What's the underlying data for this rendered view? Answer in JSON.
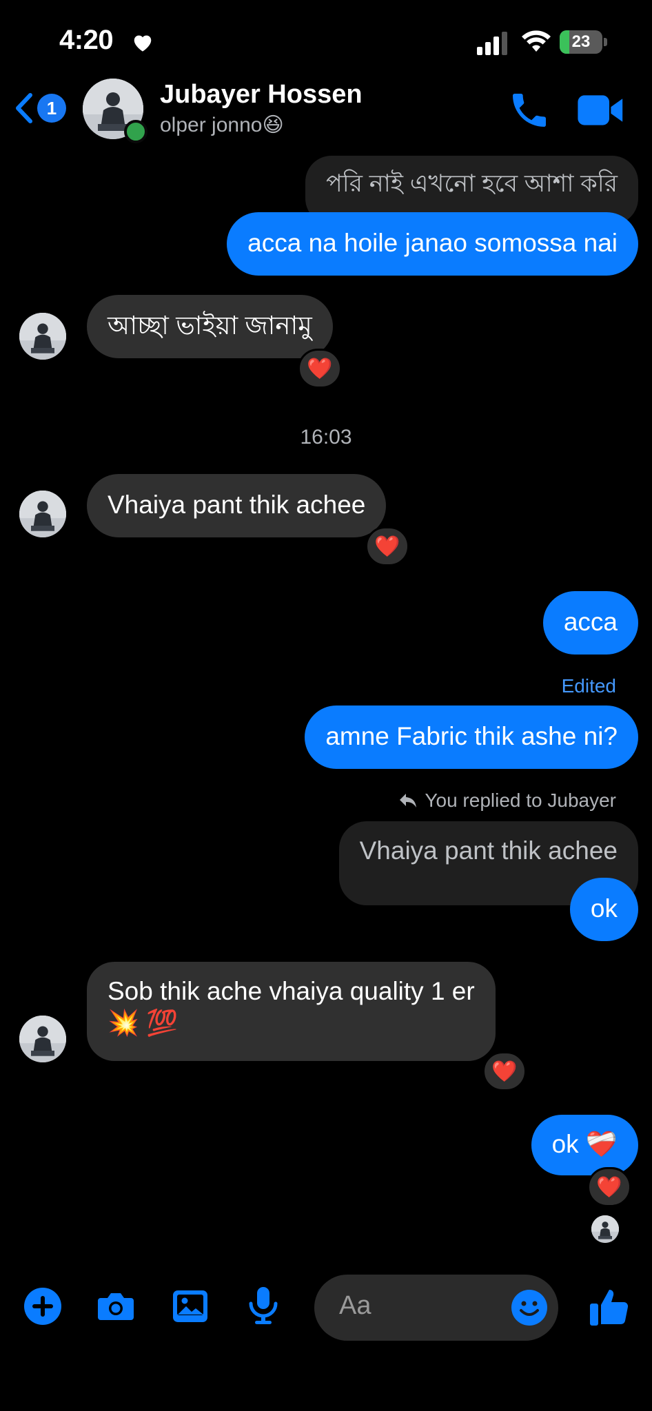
{
  "status_bar": {
    "time": "4:20",
    "battery": "23",
    "battery_level": 0.23
  },
  "header": {
    "back_badge": "1",
    "contact_name": "Jubayer Hossen",
    "subtitle": "olper jonno😆",
    "icons": [
      "chevron-left-icon",
      "phone-icon",
      "video-camera-icon"
    ]
  },
  "messages": [
    {
      "id": "m1",
      "from": "me",
      "type": "quoted",
      "text": "পরি নাই এখনো হবে আশা করি"
    },
    {
      "id": "m2",
      "from": "me",
      "text": "acca na hoile janao somossa nai"
    },
    {
      "id": "m3",
      "from": "them",
      "text": "আচ্ছা ভাইয়া জানামু",
      "reaction": "❤️"
    },
    {
      "id": "ts1",
      "type": "timestamp",
      "text": "16:03"
    },
    {
      "id": "m4",
      "from": "them",
      "text": "Vhaiya pant thik achee",
      "reaction": "❤️"
    },
    {
      "id": "m5",
      "from": "me",
      "text": "acca"
    },
    {
      "id": "m6",
      "from": "me",
      "label": "Edited",
      "text": "amne Fabric thik ashe ni?"
    },
    {
      "id": "m7",
      "from": "me",
      "reply_label": "You replied to Jubayer",
      "quoted_text": "Vhaiya pant thik achee",
      "text": "ok"
    },
    {
      "id": "m8",
      "from": "them",
      "text_line1": "Sob thik ache vhaiya quality 1 er",
      "text_line2": "💥 💯",
      "reaction": "❤️"
    },
    {
      "id": "m9",
      "from": "me",
      "text": "ok ❤️‍🩹",
      "reaction": "❤️"
    }
  ],
  "composer": {
    "placeholder": "Aa",
    "icons": [
      "plus-icon",
      "camera-icon",
      "gallery-icon",
      "microphone-icon",
      "emoji-icon",
      "thumbs-up-icon"
    ]
  },
  "colors": {
    "accent": "#0a7cff",
    "incoming_bubble": "#303030",
    "background": "#000000",
    "online": "#31a24c"
  }
}
